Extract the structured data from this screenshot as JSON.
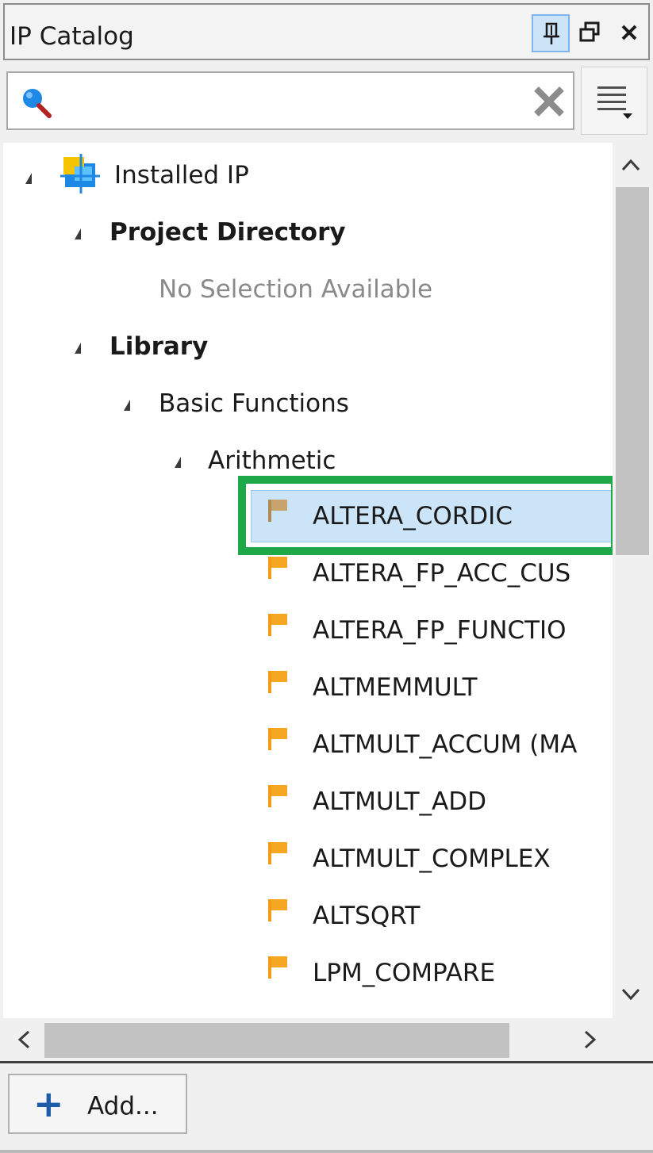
{
  "window": {
    "title": "IP Catalog"
  },
  "search": {
    "value": "",
    "placeholder": ""
  },
  "tree": {
    "root": "Installed IP",
    "project_directory": "Project Directory",
    "no_selection": "No Selection Available",
    "library": "Library",
    "basic_functions": "Basic Functions",
    "arithmetic": "Arithmetic",
    "ip_items": [
      "ALTERA_CORDIC",
      "ALTERA_FP_ACC_CUS",
      "ALTERA_FP_FUNCTIO",
      "ALTMEMMULT",
      "ALTMULT_ACCUM (MA",
      "ALTMULT_ADD",
      "ALTMULT_COMPLEX",
      "ALTSQRT",
      "LPM_COMPARE"
    ],
    "selected_item": "ALTERA_CORDIC"
  },
  "footer": {
    "add_label": "Add..."
  },
  "icons": {
    "pin": "pin-icon",
    "float": "float-window-icon",
    "close": "close-icon",
    "search": "search-icon",
    "clear": "clear-search-icon",
    "menu": "hamburger-menu-icon",
    "root": "installed-ip-icon",
    "ip": "ip-flag-icon",
    "add": "plus-icon"
  },
  "colors": {
    "selection_bg": "#cce4f7",
    "highlight_border": "#1ea84a",
    "ip_flag": "#f39c12",
    "add_plus": "#1d5da8"
  }
}
